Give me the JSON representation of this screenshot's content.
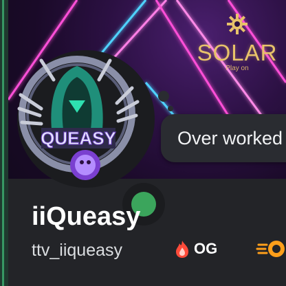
{
  "profile": {
    "display_name": "iiQueasy",
    "username": "ttv_iiqueasy",
    "status_text": "Over worked",
    "avatar_text": "QUEASY",
    "badges": [
      {
        "label": "OG",
        "icon": "fire-icon"
      },
      {
        "label": "",
        "icon": "boost-icon"
      }
    ]
  },
  "banner": {
    "brand": "SOLAR",
    "tagline": "Play on",
    "brand_color": "#e8c36a",
    "beam_colors": [
      "#ff4fd8",
      "#4fd3ff"
    ]
  },
  "presence": {
    "state": "online",
    "color": "#3ba55c"
  }
}
